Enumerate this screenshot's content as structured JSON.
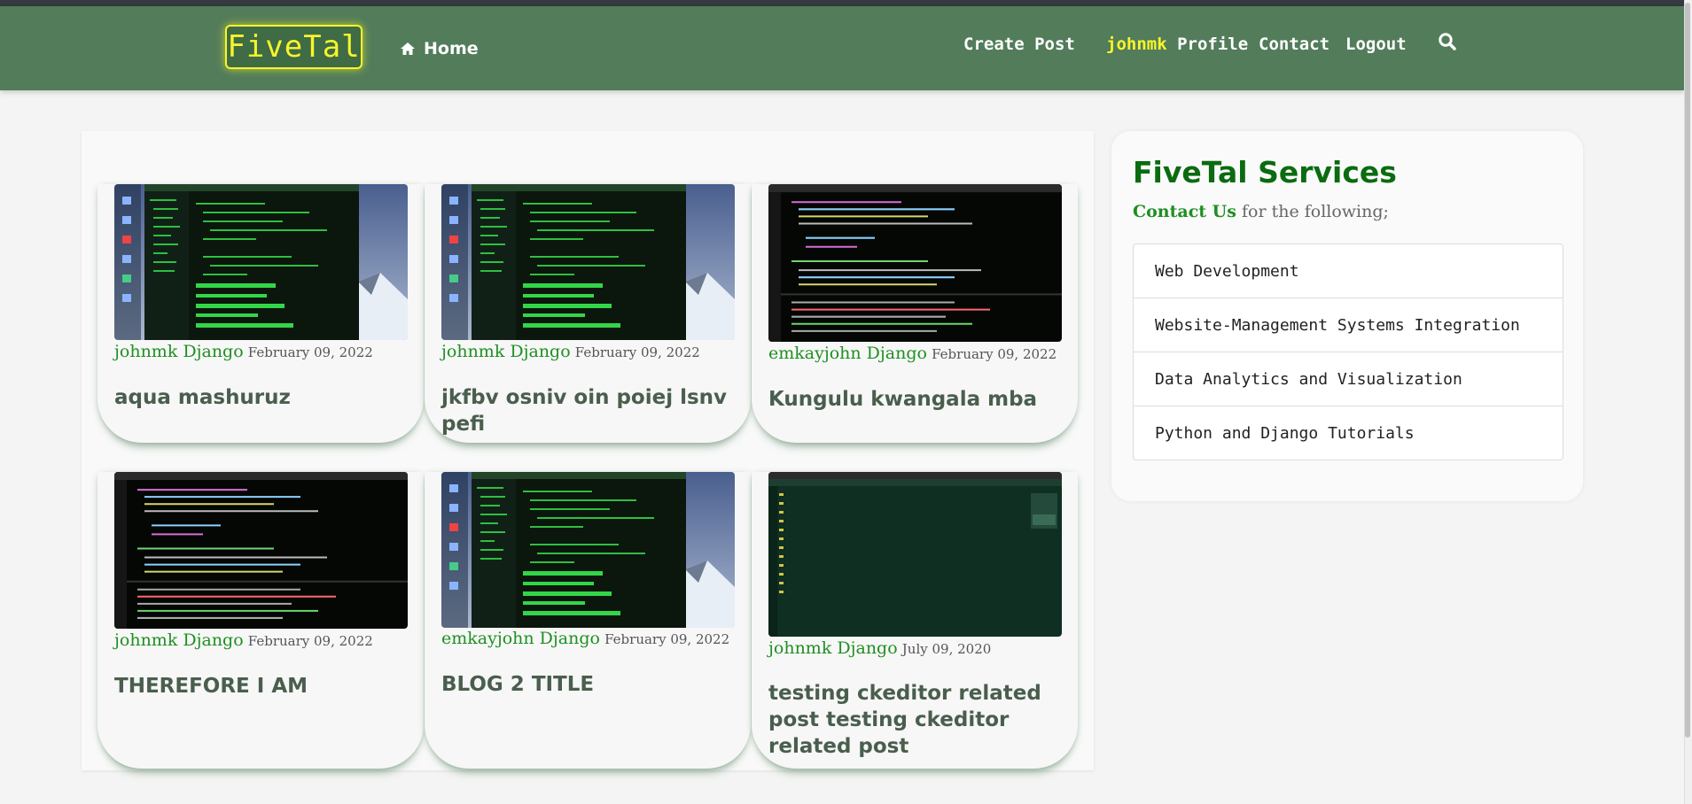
{
  "navbar": {
    "logo": "FiveTal",
    "home_label": "Home",
    "home_icon": "home-icon",
    "create_post": "Create Post",
    "username": "johnmk",
    "profile": "Profile",
    "contact": "Contact",
    "logout": "Logout",
    "search_icon": "search-icon"
  },
  "posts": [
    {
      "author": "johnmk Django",
      "date": "February 09, 2022",
      "title": "aqua mashuruz"
    },
    {
      "author": "johnmk Django",
      "date": "February 09, 2022",
      "title": "jkfbv osniv oin poiej lsnv pefi"
    },
    {
      "author": "emkayjohn Django",
      "date": "February 09, 2022",
      "title": "Kungulu kwangala mba"
    },
    {
      "author": "johnmk Django",
      "date": "February 09, 2022",
      "title": "THEREFORE I AM"
    },
    {
      "author": "emkayjohn Django",
      "date": "February 09, 2022",
      "title": "BLOG 2 TITLE"
    },
    {
      "author": "johnmk Django",
      "date": "July 09, 2020",
      "title": "testing ckeditor related post testing ckeditor related post"
    }
  ],
  "sidebar": {
    "title": "FiveTal Services",
    "contact_label": "Contact Us",
    "subtitle_rest": "for the following;",
    "services": [
      "Web Development",
      "Website-Management Systems Integration",
      "Data Analytics and Visualization",
      "Python and Django Tutorials"
    ]
  },
  "colors": {
    "navbar": "#527c5a",
    "accent_yellow": "#f7f52a",
    "link_green": "#1f8f22",
    "title_green": "#0b6b10"
  }
}
